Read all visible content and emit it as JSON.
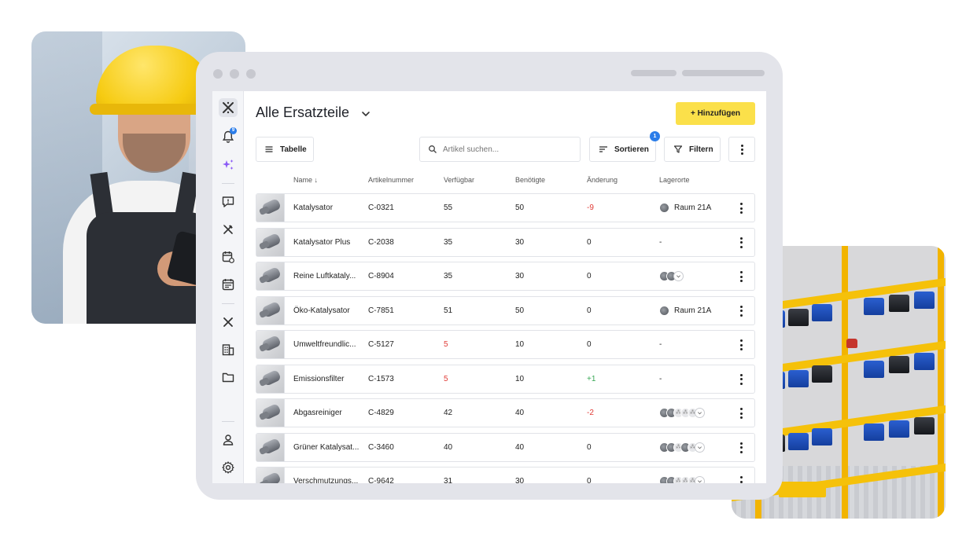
{
  "app": {
    "title": "Alle Ersatzteile",
    "add_label": "+ Hinzufügen",
    "accent": "#fbe04a",
    "badge_color": "#2b7de9",
    "notification_count": "9"
  },
  "sidebar": {
    "icons": [
      "logo-icon",
      "bell-icon",
      "sparkle-icon",
      "chat-icon",
      "tools-icon",
      "calendar-refresh-icon",
      "calendar-icon",
      "logo-small-icon",
      "building-icon",
      "folder-icon",
      "user-icon",
      "gear-icon"
    ]
  },
  "toolbar": {
    "view_label": "Tabelle",
    "search_placeholder": "Artikel suchen...",
    "sort_label": "Sortieren",
    "sort_badge": "1",
    "filter_label": "Filtern"
  },
  "table": {
    "headers": {
      "name": "Name ↓",
      "article": "Artikelnummer",
      "available": "Verfügbar",
      "needed": "Benötigte",
      "change": "Änderung",
      "locations": "Lagerorte"
    },
    "rows": [
      {
        "name": "Katalysator",
        "article": "C-0321",
        "available": "55",
        "available_low": false,
        "needed": "50",
        "change": "-9",
        "change_type": "neg",
        "location": "Raum 21A",
        "loc_type": "single"
      },
      {
        "name": "Katalysator Plus",
        "article": "C-2038",
        "available": "35",
        "available_low": false,
        "needed": "30",
        "change": "0",
        "change_type": "none",
        "location": "-",
        "loc_type": "none"
      },
      {
        "name": "Reine Luftkataly...",
        "article": "C-8904",
        "available": "35",
        "available_low": false,
        "needed": "30",
        "change": "0",
        "change_type": "none",
        "location": "",
        "loc_type": "stack2"
      },
      {
        "name": "Öko-Katalysator",
        "article": "C-7851",
        "available": "51",
        "available_low": false,
        "needed": "50",
        "change": "0",
        "change_type": "none",
        "location": "Raum 21A",
        "loc_type": "single"
      },
      {
        "name": "Umweltfreundlic...",
        "article": "C-5127",
        "available": "5",
        "available_low": true,
        "needed": "10",
        "change": "0",
        "change_type": "none",
        "location": "-",
        "loc_type": "none"
      },
      {
        "name": "Emissionsfilter",
        "article": "C-1573",
        "available": "5",
        "available_low": true,
        "needed": "10",
        "change": "+1",
        "change_type": "pos",
        "location": "-",
        "loc_type": "none"
      },
      {
        "name": "Abgasreiniger",
        "article": "C-4829",
        "available": "42",
        "available_low": false,
        "needed": "40",
        "change": "-2",
        "change_type": "neg",
        "location": "",
        "loc_type": "stack5"
      },
      {
        "name": "Grüner Katalysat...",
        "article": "C-3460",
        "available": "40",
        "available_low": false,
        "needed": "40",
        "change": "0",
        "change_type": "none",
        "location": "",
        "loc_type": "stack5"
      },
      {
        "name": "Verschmutzungs...",
        "article": "C-9642",
        "available": "31",
        "available_low": false,
        "needed": "30",
        "change": "0",
        "change_type": "none",
        "location": "",
        "loc_type": "stack5"
      }
    ]
  }
}
